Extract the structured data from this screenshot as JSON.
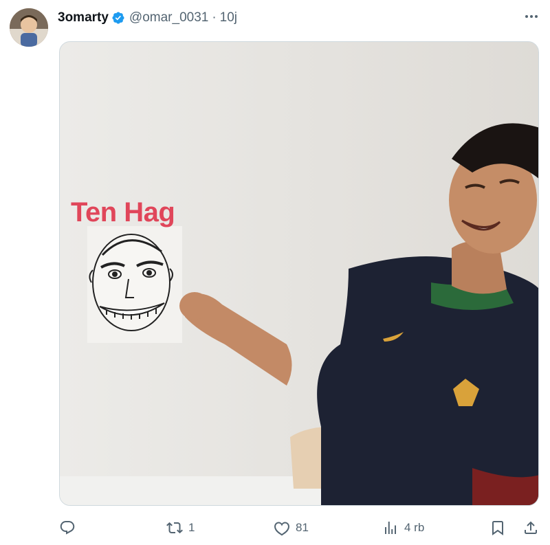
{
  "tweet": {
    "author_name": "3omarty",
    "handle": "@omar_0031",
    "separator": "·",
    "time": "10j",
    "image_caption": "Ten Hag"
  },
  "actions": {
    "reply_count": "",
    "retweet_count": "1",
    "like_count": "81",
    "views_count": "4 rb"
  },
  "colors": {
    "verified": "#1d9bf0",
    "overlay_text": "#e0465a",
    "muted": "#536471"
  },
  "icons": [
    "verified-badge-icon",
    "more-icon",
    "reply-icon",
    "retweet-icon",
    "like-icon",
    "views-icon",
    "bookmark-icon",
    "share-icon"
  ]
}
